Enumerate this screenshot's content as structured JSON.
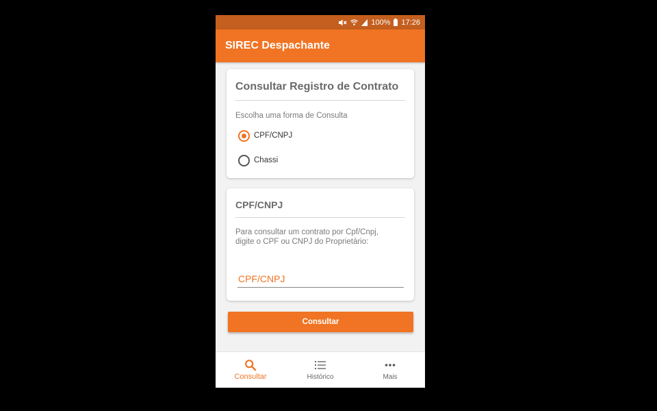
{
  "colors": {
    "accent": "#f07423",
    "status_bar": "#c45f1f",
    "background": "#f2f2f2"
  },
  "status_bar": {
    "battery": "100%",
    "time": "17:26",
    "icons": [
      "mute-icon",
      "wifi-icon",
      "signal-icon",
      "battery-icon"
    ]
  },
  "app_bar": {
    "title": "SIREC Despachante"
  },
  "consult_card": {
    "title": "Consultar Registro de Contrato",
    "prompt": "Escolha uma forma de Consulta",
    "options": [
      {
        "label": "CPF/CNPJ",
        "selected": true
      },
      {
        "label": "Chassi",
        "selected": false
      }
    ]
  },
  "cpf_card": {
    "title": "CPF/CNPJ",
    "description": "Para consultar um contrato por Cpf/Cnpj, digite o CPF ou CNPJ do Proprietário:",
    "input": {
      "placeholder": "CPF/CNPJ",
      "value": ""
    }
  },
  "submit_button": {
    "label": "Consultar"
  },
  "bottom_nav": {
    "items": [
      {
        "label": "Consultar",
        "icon": "search-icon",
        "active": true
      },
      {
        "label": "Histórico",
        "icon": "list-icon",
        "active": false
      },
      {
        "label": "Mais",
        "icon": "more-icon",
        "active": false
      }
    ]
  }
}
